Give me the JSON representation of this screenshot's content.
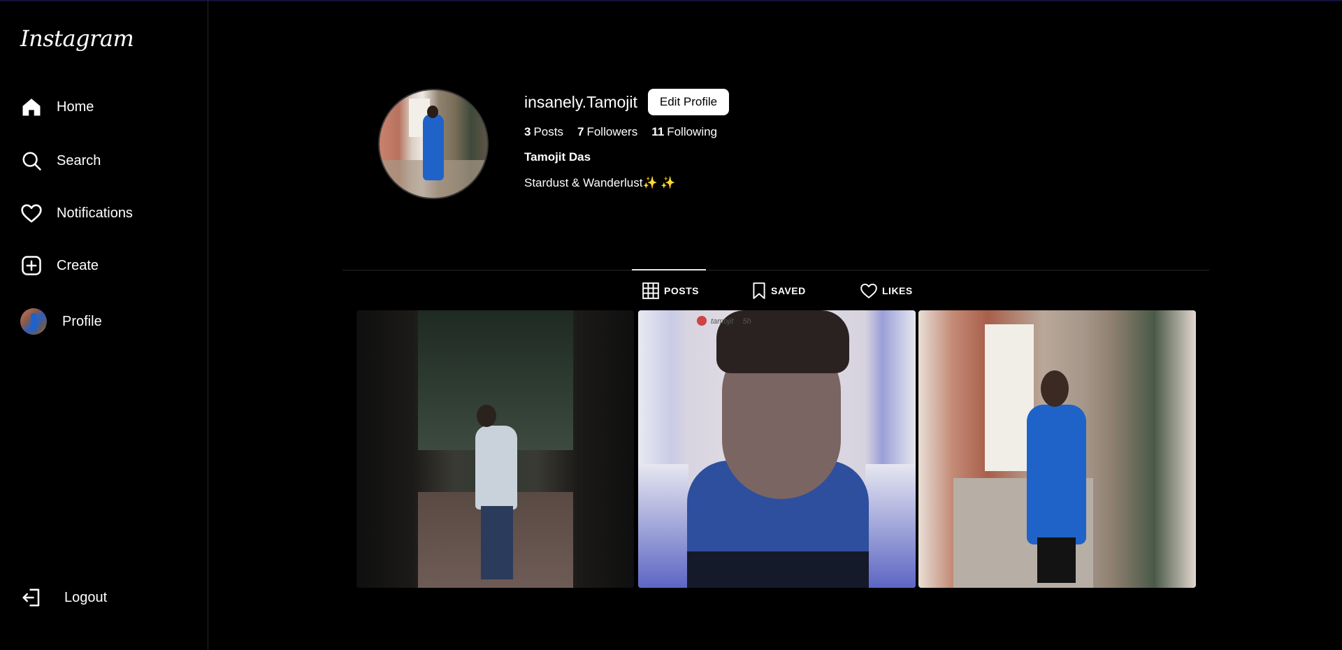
{
  "app": {
    "logo": "Instagram"
  },
  "sidebar": {
    "items": [
      {
        "label": "Home",
        "icon": "home-icon"
      },
      {
        "label": "Search",
        "icon": "search-icon"
      },
      {
        "label": "Notifications",
        "icon": "heart-icon"
      },
      {
        "label": "Create",
        "icon": "plus-square-icon"
      },
      {
        "label": "Profile",
        "icon": "avatar"
      }
    ],
    "logout": {
      "label": "Logout",
      "icon": "logout-icon"
    }
  },
  "profile": {
    "username": "insanely.Tamojit",
    "edit_button": "Edit Profile",
    "posts_count": "3",
    "posts_label": "Posts",
    "followers_count": "7",
    "followers_label": "Followers",
    "following_count": "11",
    "following_label": "Following",
    "full_name": "Tamojit Das",
    "bio": "Stardust & Wanderlust✨ ✨"
  },
  "tabs": [
    {
      "label": "POSTS",
      "icon": "grid-icon",
      "active": true
    },
    {
      "label": "SAVED",
      "icon": "bookmark-icon",
      "active": false
    },
    {
      "label": "LIKES",
      "icon": "heart-icon",
      "active": false
    }
  ],
  "posts": [
    {
      "alt": "man walking on path"
    },
    {
      "alt": "selfie in blue t-shirt",
      "overlay_user": "tamojit",
      "overlay_time": "5h"
    },
    {
      "alt": "man in blue kurta leaning by doorway"
    }
  ]
}
